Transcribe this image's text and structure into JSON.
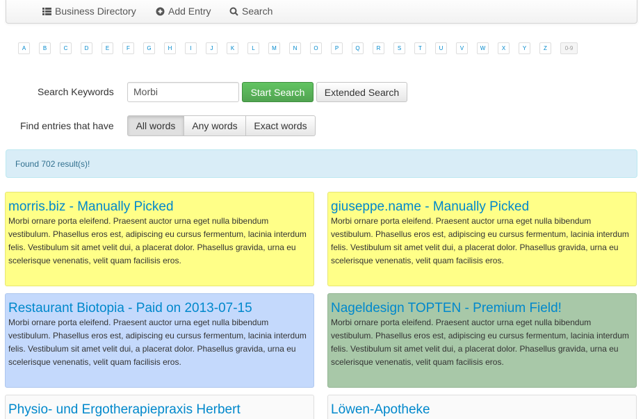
{
  "nav": {
    "items": [
      {
        "label": "Business Directory",
        "icon": "list-icon"
      },
      {
        "label": "Add Entry",
        "icon": "plus-circle-icon"
      },
      {
        "label": "Search",
        "icon": "search-icon"
      }
    ]
  },
  "alphabet": [
    "A",
    "B",
    "C",
    "D",
    "E",
    "F",
    "G",
    "H",
    "I",
    "J",
    "K",
    "L",
    "M",
    "N",
    "O",
    "P",
    "Q",
    "R",
    "S",
    "T",
    "U",
    "V",
    "W",
    "X",
    "Y",
    "Z"
  ],
  "alphabet_extra": "0-9",
  "search": {
    "keywords_label": "Search Keywords",
    "keywords_value": "Morbi",
    "start_label": "Start Search",
    "extended_label": "Extended Search",
    "mode_label": "Find entries that have",
    "modes": [
      "All words",
      "Any words",
      "Exact words"
    ],
    "active_mode": "All words"
  },
  "result_message": "Found 702 result(s)!",
  "colors": {
    "featured_yellow": "#ffff88",
    "paid_blue": "#c4d9fc",
    "premium_green": "#a8c8a8",
    "link": "#0088cc"
  },
  "listings": [
    {
      "title": "morris.biz - Manually Picked",
      "text": "Morbi ornare porta eleifend. Praesent auctor urna eget nulla bibendum vestibulum. Phasellus eros est, adipiscing eu cursus fermentum, lacinia interdum felis. Vestibulum sit amet velit dui, a placerat dolor. Phasellus gravida, urna eu scelerisque venenatis, velit quam facilisis eros."
    },
    {
      "title": "giuseppe.name - Manually Picked",
      "text": "Morbi ornare porta eleifend. Praesent auctor urna eget nulla bibendum vestibulum. Phasellus eros est, adipiscing eu cursus fermentum, lacinia interdum felis. Vestibulum sit amet velit dui, a placerat dolor. Phasellus gravida, urna eu scelerisque venenatis, velit quam facilisis eros."
    },
    {
      "title": "Restaurant Biotopia - Paid on 2013-07-15",
      "text": "Morbi ornare porta eleifend. Praesent auctor urna eget nulla bibendum vestibulum. Phasellus eros est, adipiscing eu cursus fermentum, lacinia interdum felis. Vestibulum sit amet velit dui, a placerat dolor. Phasellus gravida, urna eu scelerisque venenatis, velit quam facilisis eros."
    },
    {
      "title": "Nageldesign TOPTEN - Premium Field!",
      "text": "Morbi ornare porta eleifend. Praesent auctor urna eget nulla bibendum vestibulum. Phasellus eros est, adipiscing eu cursus fermentum, lacinia interdum felis. Vestibulum sit amet velit dui, a placerat dolor. Phasellus gravida, urna eu scelerisque venenatis, velit quam facilisis eros."
    },
    {
      "title": "Physio- und Ergotherapiepraxis Herbert"
    },
    {
      "title": "Löwen-Apotheke"
    }
  ]
}
